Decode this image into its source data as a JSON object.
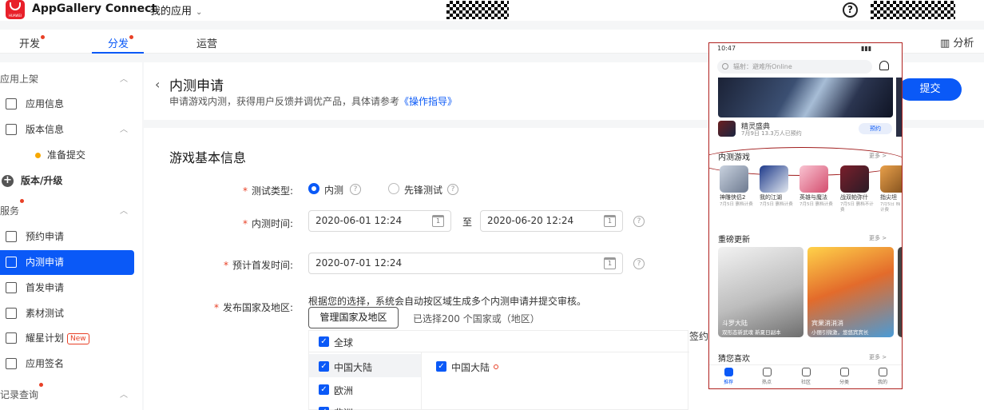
{
  "header": {
    "app_title": "AppGallery Connect",
    "logo_text": "HUAWEI",
    "app_menu": "我的应用",
    "chevron": "⌄",
    "help": "?"
  },
  "nav": {
    "tabs": [
      {
        "label": "开发",
        "badge": true
      },
      {
        "label": "分发",
        "badge": true,
        "active": true
      },
      {
        "label": "运营",
        "badge": false
      }
    ],
    "right_label": "分析"
  },
  "sidebar": {
    "items": [
      {
        "label": "应用上架",
        "type": "group"
      },
      {
        "label": "应用信息",
        "type": "item"
      },
      {
        "label": "版本信息",
        "type": "item"
      },
      {
        "label": "准备提交",
        "type": "sub"
      },
      {
        "label": "版本/升级",
        "type": "bold"
      },
      {
        "label": "服务",
        "type": "group"
      },
      {
        "label": "预约申请",
        "type": "item"
      },
      {
        "label": "内测申请",
        "type": "item",
        "active": true
      },
      {
        "label": "首发申请",
        "type": "item"
      },
      {
        "label": "素材测试",
        "type": "item"
      },
      {
        "label": "耀星计划",
        "type": "item",
        "tag": "New"
      },
      {
        "label": "应用签名",
        "type": "item"
      },
      {
        "label": "记录查询",
        "type": "group"
      }
    ]
  },
  "page": {
    "back": "‹",
    "title": "内测申请",
    "desc": "申请游戏内测，获得用户反馈并调优产品，具体请参考",
    "desc_link": "《操作指导》",
    "submit": "提交"
  },
  "form": {
    "section_title": "游戏基本信息",
    "test_type_label": "测试类型:",
    "test_type_options": [
      "内测",
      "先锋测试"
    ],
    "test_time_label": "内测时间:",
    "start_time": "2020-06-01 12:24",
    "to": "至",
    "end_time": "2020-06-20 12:24",
    "release_label": "预计首发时间:",
    "release_time": "2020-07-01 12:24",
    "region_label": "发布国家及地区:",
    "region_note": "根据您的选择，系统会自动按区域生成多个内测申请并提交审核。",
    "manage_region": "管理国家及地区",
    "selected_count": "已选择200 个国家或（地区）",
    "regions_left": [
      "全球",
      "中国大陆",
      "欧洲",
      "非洲"
    ],
    "region_right": "中国大陆",
    "sign_label": "签约"
  },
  "phone": {
    "time": "10:47",
    "search_placeholder": "辐射：避难所Online",
    "featured_title": "精灵盛典",
    "featured_meta": "7月9日  13.3万人已预约",
    "reserve": "预约",
    "sec1": "内测游戏",
    "more": "更多 >",
    "games": [
      {
        "name": "神雕侠侣2",
        "meta": "7月5日 删档计费"
      },
      {
        "name": "我的江湖",
        "meta": "7月5日 删档计费"
      },
      {
        "name": "英雄与魔法",
        "meta": "7月5日 删档计费"
      },
      {
        "name": "战双帕弥什",
        "meta": "7月5日 删档不计费"
      },
      {
        "name": "指尖坦",
        "meta": "7月5日 档计费"
      }
    ],
    "sec2": "重磅更新",
    "cards": [
      {
        "title": "斗罗大陆",
        "sub": "双形态新武魂 新夏日副本"
      },
      {
        "title": "宾果消消消",
        "sub": "小丽引微激，悠悠宾宾长"
      }
    ],
    "sec3": "猜您喜欢",
    "tabs": [
      "推荐",
      "热点",
      "社区",
      "分类",
      "我的"
    ]
  }
}
